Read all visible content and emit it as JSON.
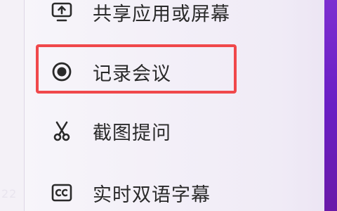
{
  "menu": {
    "items": [
      {
        "label": "共享应用或屏幕",
        "icon": "share-screen-icon"
      },
      {
        "label": "记录会议",
        "icon": "record-icon"
      },
      {
        "label": "截图提问",
        "icon": "scissors-icon"
      },
      {
        "label": "实时双语字幕",
        "icon": "closed-caption-icon"
      }
    ],
    "highlighted_index": 1
  },
  "background": {
    "partial_text": "22"
  },
  "colors": {
    "highlight": "#f0484b",
    "accent_bar": "#6a1fc4",
    "text": "#2a2a2a"
  }
}
